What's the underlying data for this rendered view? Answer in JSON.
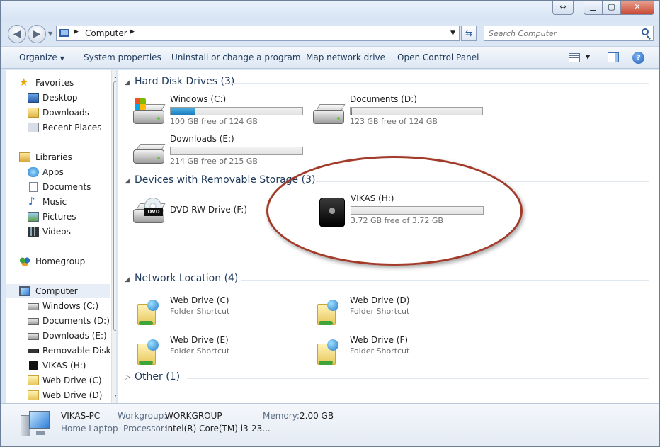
{
  "window": {
    "controls": {
      "restore": "⇔",
      "minimize": "▁",
      "maximize": "▢",
      "close": "✕"
    }
  },
  "address": {
    "location": "Computer",
    "search_placeholder": "Search Computer"
  },
  "commandbar": {
    "organize": "Organize",
    "system_properties": "System properties",
    "uninstall": "Uninstall or change a program",
    "map_drive": "Map network drive",
    "control_panel": "Open Control Panel"
  },
  "nav": {
    "favorites": "Favorites",
    "desktop": "Desktop",
    "downloads": "Downloads",
    "recent": "Recent Places",
    "libraries": "Libraries",
    "apps": "Apps",
    "documents": "Documents",
    "music": "Music",
    "pictures": "Pictures",
    "videos": "Videos",
    "homegroup": "Homegroup",
    "computer": "Computer",
    "windows_c": "Windows (C:)",
    "documents_d": "Documents (D:)",
    "downloads_e": "Downloads (E:)",
    "removable": "Removable Disk (",
    "vikas": "VIKAS (H:)",
    "webdrive_c": "Web Drive (C)",
    "webdrive_d": "Web Drive (D)"
  },
  "groups": {
    "hdd": "Hard Disk Drives (3)",
    "removable": "Devices with Removable Storage (3)",
    "network": "Network Location (4)",
    "other": "Other (1)"
  },
  "drives": [
    {
      "name": "Windows (C:)",
      "free": "100 GB free of 124 GB",
      "used_fraction": 0.19
    },
    {
      "name": "Documents (D:)",
      "free": "123 GB free of 124 GB",
      "used_fraction": 0.01
    },
    {
      "name": "Downloads (E:)",
      "free": "214 GB free of 215 GB",
      "used_fraction": 0.005
    },
    {
      "name": "DVD RW Drive (F:)"
    },
    {
      "name": "VIKAS (H:)",
      "free": "3.72 GB free of 3.72 GB",
      "used_fraction": 0.0
    }
  ],
  "network": [
    {
      "name": "Web Drive (C)",
      "type": "Folder Shortcut"
    },
    {
      "name": "Web Drive (D)",
      "type": "Folder Shortcut"
    },
    {
      "name": "Web Drive (E)",
      "type": "Folder Shortcut"
    },
    {
      "name": "Web Drive (F)",
      "type": "Folder Shortcut"
    }
  ],
  "details": {
    "pc_name": "VIKAS-PC",
    "pc_desc": "Home Laptop",
    "workgroup_label": "Workgroup:",
    "workgroup": "WORKGROUP",
    "memory_label": "Memory:",
    "memory": "2.00 GB",
    "processor_label": "Processor:",
    "processor": "Intel(R) Core(TM) i3-23..."
  },
  "colors": {
    "accent": "#1e395b",
    "bar_fill": "#1a7ec0",
    "annotation": "#a23b2a"
  }
}
